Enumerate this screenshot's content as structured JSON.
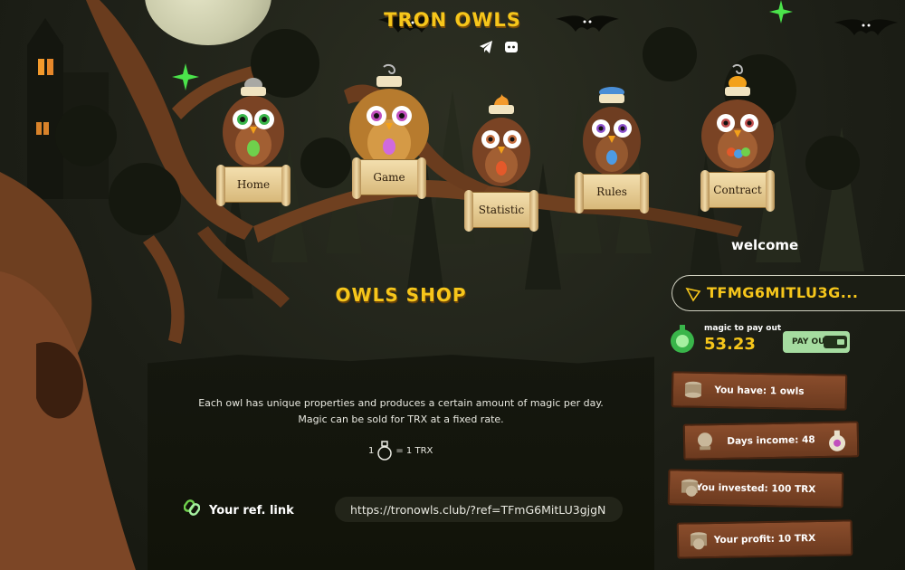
{
  "header": {
    "logo": "TRON OWLS",
    "social": [
      "telegram-icon",
      "discord-icon"
    ]
  },
  "nav": {
    "items": [
      {
        "label": "Home"
      },
      {
        "label": "Game"
      },
      {
        "label": "Statistic"
      },
      {
        "label": "Rules"
      },
      {
        "label": "Contract"
      }
    ]
  },
  "account": {
    "welcome": "welcome",
    "address": "TFMG6MITLU3G...",
    "magic_label": "magic to pay out",
    "magic_value": "53.23",
    "payout_label": "PAY OUT"
  },
  "stats": {
    "owls": "You have: 1 owls",
    "income": "Days income: 48",
    "invested": "You invested: 100 TRX",
    "profit": "Your profit: 10 TRX"
  },
  "shop": {
    "title": "OWLS SHOP",
    "line1": "Each owl has unique properties and produces a certain amount of magic per day.",
    "line2": "Magic can be sold for TRX at a fixed rate.",
    "rate_left": "1",
    "rate_right": "= 1 TRX",
    "ref_label": "Your ref. link",
    "ref_url": "https://tronowls.club/?ref=TFmG6MitLU3gjgN"
  },
  "colors": {
    "accent": "#f6c61b",
    "board": "#7a4426",
    "payout": "#a5dca0",
    "background": "#1f2118"
  }
}
